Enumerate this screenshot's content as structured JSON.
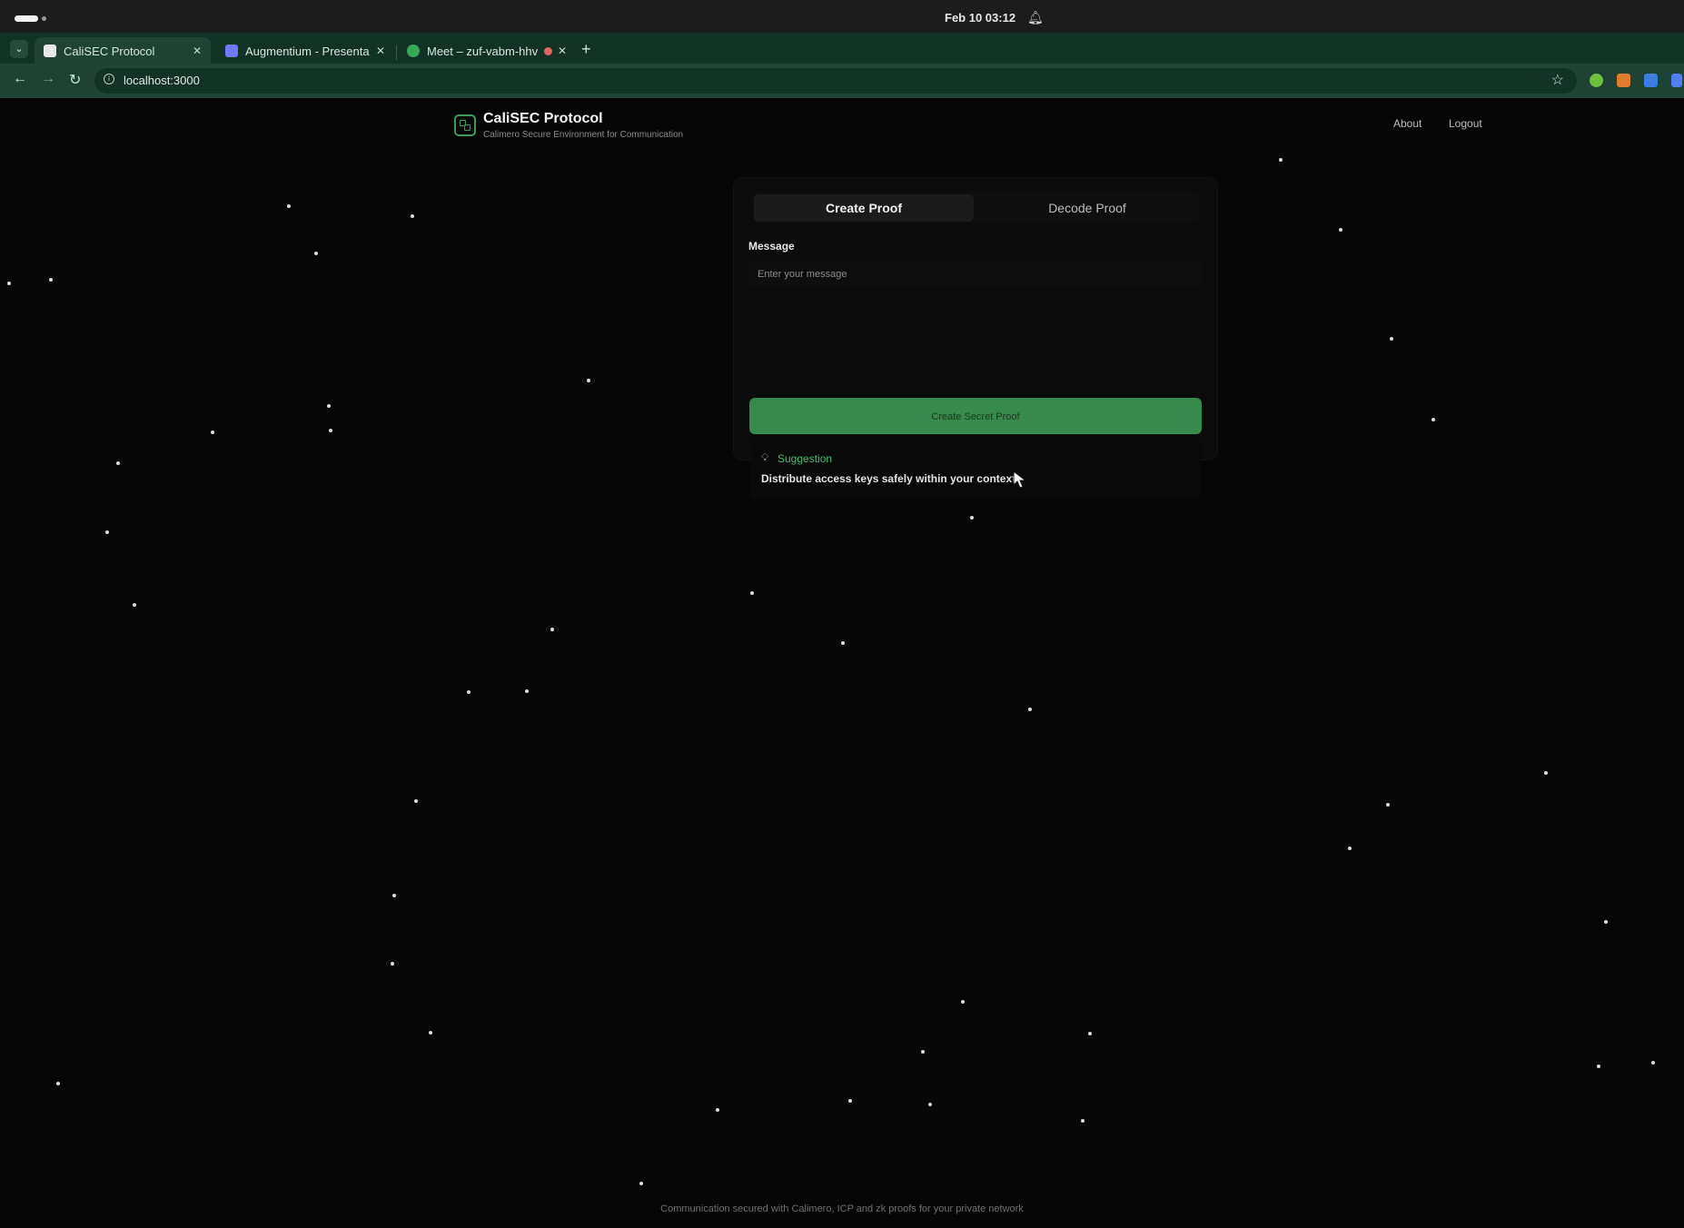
{
  "os": {
    "clock": "Feb 10  03:12",
    "bell_icon": "bell-icon"
  },
  "browser": {
    "tabs": [
      {
        "title": "CaliSEC Protocol",
        "active": true,
        "favicon_color": "#e9e9e9"
      },
      {
        "title": "Augmentium - Presenta",
        "active": false,
        "favicon_color": "#6e7bff"
      },
      {
        "title": "Meet – zuf-vabm-hhv",
        "active": false,
        "favicon_color": "#34a853"
      }
    ],
    "url": "localhost:3000"
  },
  "header": {
    "title": "CaliSEC Protocol",
    "subtitle": "Calimero Secure Environment for Communication",
    "nav": {
      "about": "About",
      "logout": "Logout"
    }
  },
  "card": {
    "tabs": {
      "create": "Create Proof",
      "decode": "Decode Proof"
    },
    "message_label": "Message",
    "message_placeholder": "Enter your message",
    "create_button": "Create Secret Proof",
    "suggestion_title": "Suggestion",
    "suggestion_text": "Distribute access keys safely within your context."
  },
  "footer": {
    "text": "Communication secured with Calimero, ICP and zk proofs for your private network"
  },
  "colors": {
    "accent": "#37894d",
    "accent_text": "#4cba6f",
    "tab_strip": "#133226",
    "page_bg": "#060606"
  }
}
